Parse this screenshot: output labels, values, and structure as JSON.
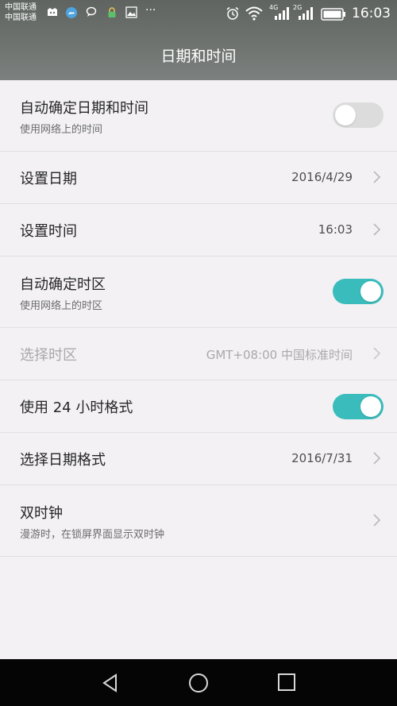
{
  "status_bar": {
    "carrier_1": "中国联通",
    "carrier_2": "中国联通",
    "more": "···",
    "net_4g": "4G",
    "net_2g": "2G",
    "time": "16:03",
    "icons": [
      "mi-icon",
      "weather-icon",
      "message-icon",
      "lock-icon",
      "image-icon",
      "alarm-icon",
      "wifi-icon",
      "signal-icon",
      "signal-icon",
      "battery-icon"
    ]
  },
  "header": {
    "title": "日期和时间"
  },
  "settings": [
    {
      "title": "自动确定日期和时间",
      "subtitle": "使用网络上的时间",
      "toggle": "off"
    },
    {
      "title": "设置日期",
      "value": "2016/4/29"
    },
    {
      "title": "设置时间",
      "value": "16:03"
    },
    {
      "title": "自动确定时区",
      "subtitle": "使用网络上的时区",
      "toggle": "on"
    },
    {
      "title": "选择时区",
      "value": "GMT+08:00 中国标准时间",
      "disabled": true
    },
    {
      "title": "使用 24 小时格式",
      "toggle": "on"
    },
    {
      "title": "选择日期格式",
      "value": "2016/7/31"
    },
    {
      "title": "双时钟",
      "subtitle": "漫游时，在锁屏界面显示双时钟"
    }
  ],
  "colors": {
    "accent": "#3bbcbc",
    "header": "#6e7370",
    "background": "#f3f1f4"
  },
  "navbar": {
    "icons": [
      "back-icon",
      "home-icon",
      "recents-icon"
    ]
  }
}
